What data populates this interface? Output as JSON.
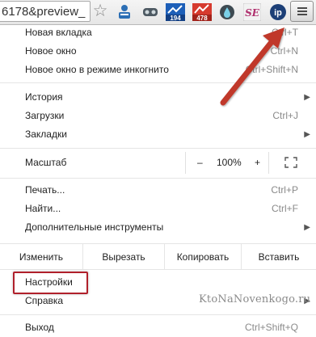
{
  "toolbar": {
    "url_text": "6178&preview_",
    "ext_badge_1": "194",
    "ext_badge_2": "478",
    "ext_se_label": "SE",
    "ext_ip_label": "ip"
  },
  "menu": {
    "new_tab": "Новая вкладка",
    "new_tab_shortcut": "Ctrl+T",
    "new_window": "Новое окно",
    "new_window_shortcut": "Ctrl+N",
    "incognito": "Новое окно в режиме инкогнито",
    "incognito_shortcut": "Ctrl+Shift+N",
    "history": "История",
    "downloads": "Загрузки",
    "downloads_shortcut": "Ctrl+J",
    "bookmarks": "Закладки",
    "zoom_label": "Масштаб",
    "zoom_minus": "–",
    "zoom_value": "100%",
    "zoom_plus": "+",
    "print": "Печать...",
    "print_shortcut": "Ctrl+P",
    "find": "Найти...",
    "find_shortcut": "Ctrl+F",
    "more_tools": "Дополнительные инструменты",
    "edit_label": "Изменить",
    "cut": "Вырезать",
    "copy": "Копировать",
    "paste": "Вставить",
    "settings": "Настройки",
    "help": "Справка",
    "exit": "Выход",
    "exit_shortcut": "Ctrl+Shift+Q"
  },
  "watermark": "KtoNaNovenkogo.ru",
  "colors": {
    "highlight_border": "#b0202b",
    "arrow": "#c0392b"
  }
}
